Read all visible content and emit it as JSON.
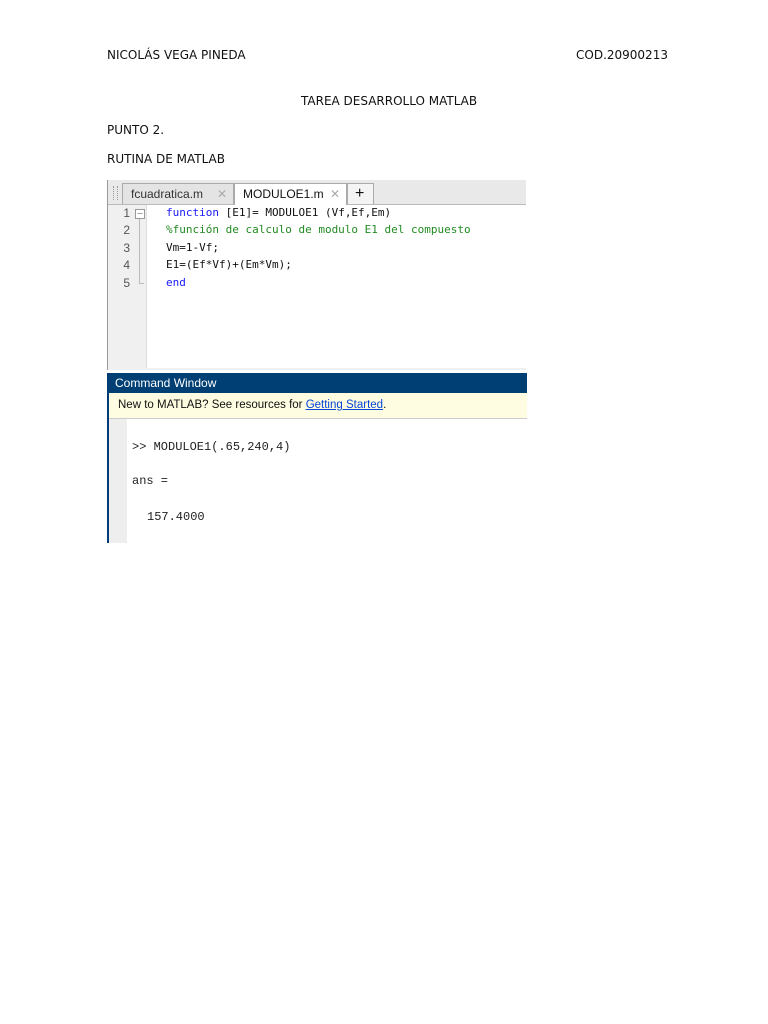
{
  "header": {
    "author": "NICOLÁS VEGA PINEDA",
    "code": "COD.20900213"
  },
  "title": "TAREA DESARROLLO MATLAB",
  "section": "PUNTO 2.",
  "subsection": "RUTINA DE MATLAB",
  "editor": {
    "tabs": [
      {
        "label": "fcuadratica.m",
        "close": "✕"
      },
      {
        "label": "MODULOE1.m",
        "close": "✕"
      }
    ],
    "add_tab": "+",
    "lines": [
      {
        "num": "1",
        "kw": "function",
        "text": " [E1]= MODULOE1 (Vf,Ef,Em)"
      },
      {
        "num": "2",
        "comment": "%función de calculo de modulo E1 del compuesto"
      },
      {
        "num": "3",
        "text": "Vm=1-Vf;"
      },
      {
        "num": "4",
        "text": "E1=(Ef*Vf)+(Em*Vm);"
      },
      {
        "num": "5",
        "kw": "end"
      }
    ]
  },
  "command_window": {
    "title": "Command Window",
    "tip_prefix": "New to MATLAB? See resources for ",
    "tip_link": "Getting Started",
    "tip_suffix": ".",
    "command": ">> MODULOE1(.65,240,4)",
    "ans_label": "ans =",
    "result": "157.4000"
  }
}
